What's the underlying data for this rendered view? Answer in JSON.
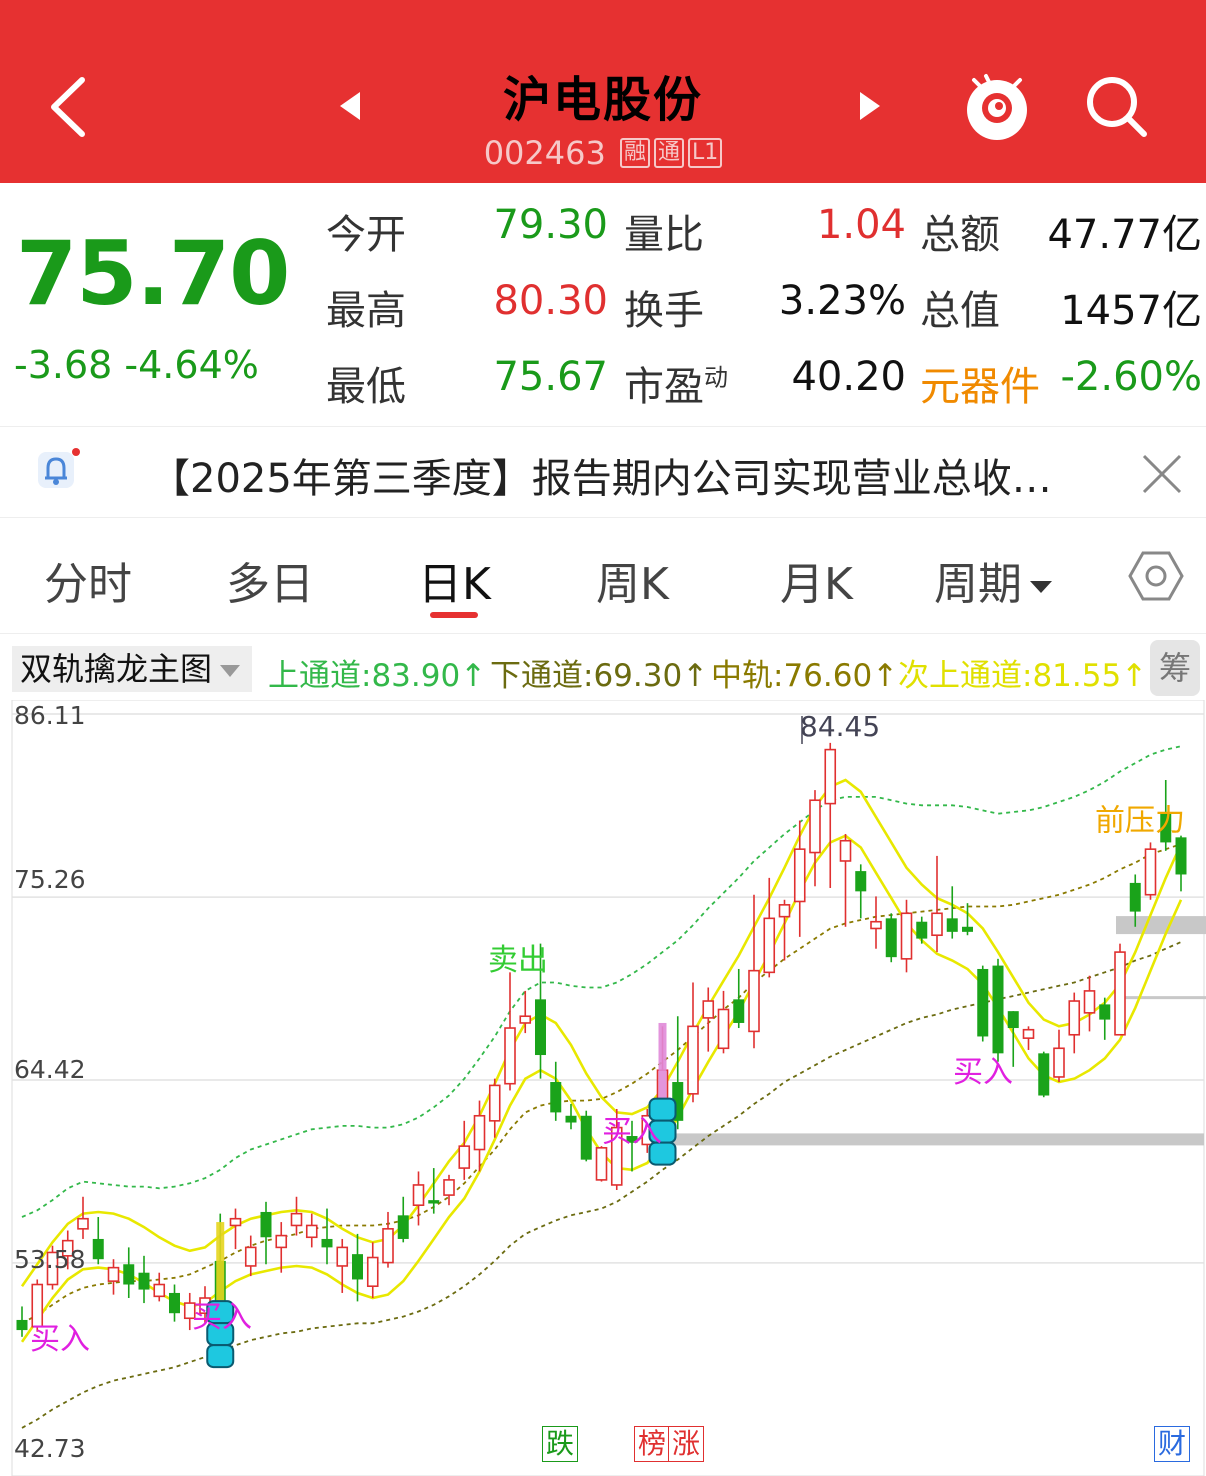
{
  "header": {
    "title": "沪电股份",
    "code": "002463",
    "tags": [
      "融",
      "通",
      "L1"
    ]
  },
  "quote": {
    "price": "75.70",
    "change": "-3.68",
    "change_pct": "-4.64%",
    "rows": [
      {
        "l1": "今开",
        "v1": "79.30",
        "l2": "量比",
        "v2": "1.04",
        "l3": "总额",
        "v3": "47.77亿"
      },
      {
        "l1": "最高",
        "v1": "80.30",
        "l2": "换手",
        "v2": "3.23%",
        "l3": "总值",
        "v3": "1457亿"
      },
      {
        "l1": "最低",
        "v1": "75.67",
        "l2": "市盈",
        "l2_sup": "动",
        "v2": "40.20",
        "l3": "元器件",
        "v3": "-2.60%"
      }
    ],
    "colors": {
      "down": "#1a9a1a",
      "up": "#e03030",
      "sector": "#f08a00"
    }
  },
  "notice": {
    "text": "【2025年第三季度】报告期内公司实现营业总收…"
  },
  "tabs": [
    "分时",
    "多日",
    "日K",
    "周K",
    "月K",
    "周期"
  ],
  "active_tab": "日K",
  "indicator": {
    "name": "双轨擒龙主图",
    "items": [
      {
        "label": "上通道:83.90↑",
        "color": "#33b84a"
      },
      {
        "label": "下通道:69.30↑",
        "color": "#6b6b10"
      },
      {
        "label": "中轨:76.60↑",
        "color": "#8a7a00"
      },
      {
        "label": "次上通道:81.55↑",
        "color": "#e8e800"
      }
    ],
    "chip": "筹"
  },
  "chart_data": {
    "type": "candlestick",
    "y_ticks": [
      "86.11",
      "75.26",
      "64.42",
      "53.58",
      "42.73"
    ],
    "ylim": [
      42.73,
      86.11
    ],
    "high_label": "84.45",
    "annotations": [
      "卖出",
      "买入",
      "买入",
      "买入",
      "买入",
      "前压力"
    ],
    "candles": [
      [
        50.2,
        49.6,
        51.0,
        49.2
      ],
      [
        49.8,
        52.3,
        52.6,
        49.5
      ],
      [
        52.3,
        54.2,
        54.6,
        52.0
      ],
      [
        54.0,
        54.9,
        55.5,
        53.2
      ],
      [
        55.6,
        56.2,
        57.5,
        55.0
      ],
      [
        55.0,
        53.8,
        56.3,
        53.5
      ],
      [
        52.5,
        53.3,
        53.8,
        51.7
      ],
      [
        53.5,
        52.3,
        54.5,
        51.5
      ],
      [
        53.0,
        52.0,
        54.0,
        51.2
      ],
      [
        51.6,
        52.3,
        53.0,
        51.3
      ],
      [
        51.8,
        50.6,
        52.3,
        50.1
      ],
      [
        50.3,
        51.2,
        51.8,
        49.6
      ],
      [
        50.6,
        51.5,
        52.2,
        50.0
      ],
      [
        53.7,
        50.6,
        56.5,
        50.2
      ],
      [
        55.8,
        56.2,
        56.8,
        54.4
      ],
      [
        53.4,
        54.5,
        55.2,
        52.8
      ],
      [
        56.6,
        55.1,
        57.2,
        53.5
      ],
      [
        54.5,
        55.2,
        56.0,
        53.0
      ],
      [
        55.8,
        56.5,
        57.5,
        55.2
      ],
      [
        55.1,
        55.8,
        56.5,
        54.5
      ],
      [
        55.0,
        54.5,
        56.8,
        53.5
      ],
      [
        53.4,
        54.5,
        55.0,
        51.8
      ],
      [
        54.1,
        52.6,
        55.3,
        51.3
      ],
      [
        52.2,
        53.9,
        54.8,
        51.5
      ],
      [
        53.6,
        55.6,
        56.6,
        53.3
      ],
      [
        56.4,
        55.0,
        57.5,
        54.8
      ],
      [
        57.0,
        58.2,
        59.0,
        55.8
      ],
      [
        57.3,
        57.1,
        59.2,
        56.5
      ],
      [
        57.6,
        58.5,
        58.8,
        57.0
      ],
      [
        59.2,
        60.5,
        62.0,
        58.5
      ],
      [
        60.3,
        62.3,
        63.2,
        59.0
      ],
      [
        62.0,
        64.1,
        64.5,
        61.0
      ],
      [
        64.2,
        67.5,
        70.8,
        63.8
      ],
      [
        67.8,
        68.2,
        69.7,
        67.2
      ],
      [
        69.2,
        65.9,
        72.5,
        64.5
      ],
      [
        64.3,
        62.5,
        65.5,
        62.0
      ],
      [
        62.3,
        61.9,
        63.0,
        61.5
      ],
      [
        62.3,
        59.7,
        62.6,
        59.6
      ],
      [
        58.5,
        60.4,
        60.5,
        58.4
      ],
      [
        58.2,
        61.6,
        62.7,
        57.9
      ],
      [
        61.1,
        60.7,
        62.0,
        59.0
      ],
      [
        60.6,
        62.3,
        62.7,
        60.1
      ],
      [
        62.1,
        65.0,
        67.6,
        61.2
      ],
      [
        64.3,
        62.0,
        68.2,
        61.5
      ],
      [
        63.6,
        67.6,
        70.2,
        63.1
      ],
      [
        68.1,
        69.1,
        69.9,
        66.1
      ],
      [
        66.3,
        68.6,
        69.7,
        66.0
      ],
      [
        69.2,
        67.8,
        71.0,
        67.5
      ],
      [
        67.3,
        70.9,
        75.4,
        66.3
      ],
      [
        70.8,
        74.0,
        76.4,
        70.5
      ],
      [
        74.1,
        74.8,
        75.1,
        71.5
      ],
      [
        75.0,
        78.1,
        79.8,
        72.9
      ],
      [
        77.9,
        81.0,
        81.6,
        75.9
      ],
      [
        80.8,
        84.0,
        84.4,
        75.8
      ],
      [
        77.4,
        78.6,
        79.0,
        73.5
      ],
      [
        76.8,
        75.6,
        77.2,
        74.0
      ],
      [
        73.4,
        73.8,
        75.3,
        72.2
      ],
      [
        74.0,
        71.7,
        74.3,
        71.4
      ],
      [
        71.6,
        74.3,
        75.1,
        70.8
      ],
      [
        73.8,
        72.8,
        74.1,
        72.5
      ],
      [
        73.0,
        74.3,
        77.7,
        72.0
      ],
      [
        74.0,
        73.2,
        75.9,
        72.8
      ],
      [
        73.5,
        73.2,
        74.9,
        73.0
      ],
      [
        71.0,
        67.0,
        71.2,
        66.7
      ],
      [
        71.2,
        66.0,
        71.6,
        65.5
      ],
      [
        68.5,
        67.5,
        68.5,
        65.2
      ],
      [
        66.9,
        67.4,
        67.6,
        66.2
      ],
      [
        66.0,
        63.5,
        66.1,
        63.4
      ],
      [
        64.6,
        66.3,
        67.4,
        64.3
      ],
      [
        67.1,
        69.1,
        69.6,
        66.0
      ],
      [
        68.4,
        69.7,
        70.6,
        67.3
      ],
      [
        68.9,
        68.0,
        69.3,
        66.8
      ],
      [
        67.1,
        72.0,
        72.5,
        67.3
      ],
      [
        76.1,
        74.4,
        76.6,
        73.5
      ],
      [
        75.4,
        78.1,
        78.5,
        75.1
      ],
      [
        80.3,
        78.5,
        82.2,
        78.0
      ],
      [
        78.8,
        76.6,
        78.9,
        75.6
      ]
    ],
    "series": [
      {
        "name": "上通道",
        "color": "#33b84a",
        "values": [
          56.3,
          56.7,
          57.3,
          58.0,
          58.4,
          58.3,
          58.2,
          58.1,
          58.1,
          58.0,
          58.1,
          58.3,
          58.6,
          59.1,
          59.8,
          60.3,
          60.6,
          60.9,
          61.2,
          61.5,
          61.6,
          61.7,
          61.7,
          61.6,
          61.6,
          61.8,
          62.2,
          62.8,
          63.5,
          64.5,
          65.7,
          67.0,
          68.5,
          69.7,
          70.2,
          70.2,
          70.0,
          69.9,
          69.9,
          70.2,
          70.7,
          71.3,
          72.0,
          72.7,
          73.6,
          74.6,
          75.5,
          76.4,
          77.4,
          78.2,
          79.0,
          79.7,
          80.4,
          81.0,
          81.2,
          81.2,
          81.2,
          81.0,
          80.8,
          80.7,
          80.7,
          80.7,
          80.6,
          80.4,
          80.2,
          80.3,
          80.4,
          80.6,
          80.9,
          81.2,
          81.6,
          82.1,
          82.7,
          83.2,
          83.7,
          84.0,
          84.2
        ]
      },
      {
        "name": "下通道",
        "color": "#6b6b10",
        "values": [
          43.8,
          44.3,
          44.9,
          45.4,
          45.9,
          46.3,
          46.6,
          46.8,
          47.0,
          47.2,
          47.4,
          47.7,
          48.0,
          48.3,
          48.7,
          49.0,
          49.2,
          49.4,
          49.5,
          49.7,
          49.8,
          49.9,
          50.0,
          50.0,
          50.2,
          50.4,
          50.7,
          51.1,
          51.6,
          52.2,
          52.9,
          53.7,
          54.6,
          55.3,
          55.7,
          56.1,
          56.4,
          56.6,
          56.8,
          57.2,
          57.8,
          58.4,
          59.1,
          59.7,
          60.4,
          61.1,
          61.7,
          62.3,
          63.0,
          63.6,
          64.3,
          64.8,
          65.3,
          65.8,
          66.2,
          66.6,
          67.0,
          67.4,
          67.8,
          68.1,
          68.3,
          68.6,
          68.8,
          69.0,
          69.2,
          69.4,
          69.6,
          69.8,
          70.0,
          70.2,
          70.5,
          70.8,
          71.1,
          71.5,
          71.8,
          72.2,
          72.6
        ]
      },
      {
        "name": "中轨",
        "color": "#8a7a00",
        "values": [
          50.0,
          50.5,
          51.1,
          51.7,
          52.1,
          52.3,
          52.4,
          52.5,
          52.5,
          52.6,
          52.7,
          52.9,
          53.3,
          53.7,
          54.2,
          54.6,
          54.9,
          55.1,
          55.3,
          55.6,
          55.7,
          55.8,
          55.8,
          55.8,
          55.9,
          56.1,
          56.4,
          56.9,
          57.5,
          58.3,
          59.3,
          60.3,
          61.5,
          62.5,
          62.9,
          63.1,
          63.2,
          63.2,
          63.3,
          63.7,
          64.2,
          64.8,
          65.5,
          66.2,
          67.0,
          67.8,
          68.6,
          69.3,
          70.2,
          70.9,
          71.6,
          72.2,
          72.8,
          73.4,
          73.7,
          73.9,
          74.1,
          74.2,
          74.3,
          74.4,
          74.5,
          74.6,
          74.7,
          74.7,
          74.7,
          74.8,
          75.0,
          75.2,
          75.4,
          75.7,
          76.0,
          76.4,
          76.9,
          77.3,
          77.8,
          78.1,
          78.4
        ]
      },
      {
        "name": "次上通道",
        "color": "#e8e800",
        "values": [
          52.2,
          53.5,
          54.8,
          55.9,
          56.5,
          56.6,
          56.5,
          56.2,
          55.7,
          55.1,
          54.6,
          54.3,
          54.5,
          55.2,
          55.8,
          56.2,
          56.4,
          56.6,
          56.7,
          56.6,
          56.2,
          55.6,
          55.1,
          54.8,
          55.0,
          55.8,
          57.0,
          58.3,
          59.6,
          60.7,
          62.3,
          64.2,
          66.2,
          67.8,
          68.3,
          67.8,
          66.5,
          64.8,
          63.4,
          62.5,
          62.4,
          62.8,
          63.9,
          65.5,
          67.2,
          68.8,
          70.3,
          71.8,
          73.5,
          75.2,
          77.0,
          78.9,
          80.6,
          81.8,
          82.2,
          81.5,
          80.0,
          78.5,
          77.0,
          76.0,
          75.2,
          74.8,
          74.3,
          73.4,
          72.0,
          70.5,
          69.0,
          68.0,
          67.6,
          67.8,
          68.3,
          69.0,
          70.1,
          72.0,
          74.2,
          76.4,
          78.4
        ]
      }
    ]
  },
  "events": [
    {
      "label": "跌",
      "color": "#1a9a1a"
    },
    {
      "label": "榜",
      "color": "#e03030"
    },
    {
      "label": "涨",
      "color": "#e03030"
    },
    {
      "label": "财",
      "color": "#2a6adf"
    }
  ]
}
